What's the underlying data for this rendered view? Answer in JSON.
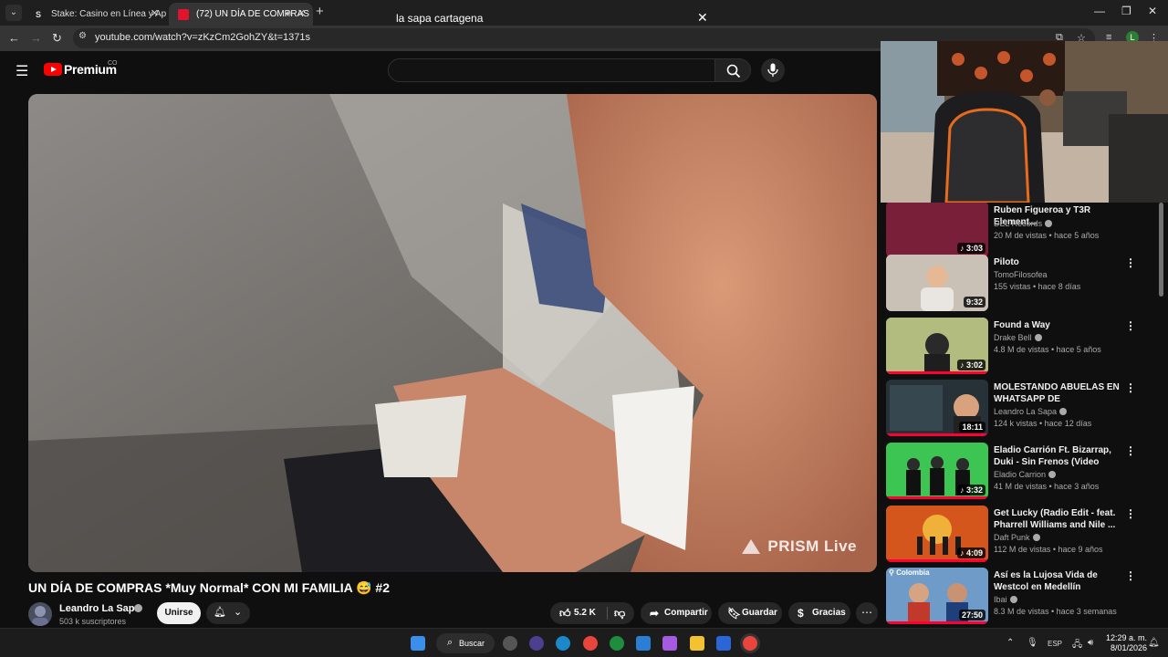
{
  "browser": {
    "tabs": [
      {
        "title": "Stake: Casino en Línea y Apuest",
        "favicon": "S"
      },
      {
        "title": "(72) UN DÍA DE COMPRAS",
        "active": true
      }
    ],
    "url": "youtube.com/watch?v=zKzCm2GohZY&t=1371s",
    "profile_initial": "L"
  },
  "youtube": {
    "brand": "Premium",
    "country": "CO",
    "search_value": "la sapa cartagena"
  },
  "video": {
    "watermark": "PRISM Live",
    "title": "UN DÍA DE COMPRAS *Muy Normal* CON MI FAMILIA 😅 #2",
    "channel": "Leandro La Sapa",
    "subscribers": "503 k suscriptores",
    "join_label": "Unirse",
    "likes": "5.2 K",
    "share_label": "Compartir",
    "save_label": "Guardar",
    "thanks_label": "Gracias"
  },
  "recommendations": [
    {
      "title": "Ruben Figueroa y T3R Element...",
      "channel": "DEL Records",
      "verified": true,
      "meta": "20 M de vistas • hace 5 años",
      "duration": "3:03",
      "music": true,
      "progress": 1.0,
      "thumb_color": "#7a1f3a"
    },
    {
      "title": "Piloto",
      "channel": "TomoFilosofea",
      "verified": false,
      "meta": "155 vistas • hace 8 días",
      "duration": "9:32",
      "music": false,
      "progress": 0,
      "thumb_color": "#b7aea4"
    },
    {
      "title": "Found a Way",
      "channel": "Drake Bell",
      "verified": true,
      "meta": "4.8 M de vistas • hace 5 años",
      "duration": "3:02",
      "music": true,
      "progress": 1.0,
      "thumb_color": "#a7b44a"
    },
    {
      "title": "MOLESTANDO ABUELAS EN WHATSAPP DE SEGUIDORES ...",
      "channel": "Leandro La Sapa",
      "verified": true,
      "meta": "124 k vistas • hace 12 días",
      "duration": "18:11",
      "music": false,
      "progress": 1.0,
      "thumb_color": "#3a3f4a"
    },
    {
      "title": "Eladio Carrión Ft. Bizarrap, Duki - Sin Frenos (Video Oficial)",
      "channel": "Eladio Carrion",
      "verified": true,
      "meta": "41 M de vistas • hace 3 años",
      "duration": "3:32",
      "music": true,
      "progress": 1.0,
      "thumb_color": "#35b34a"
    },
    {
      "title": "Get Lucky (Radio Edit - feat. Pharrell Williams and Nile ...",
      "channel": "Daft Punk",
      "verified": true,
      "meta": "112 M de vistas • hace 9 años",
      "duration": "4:09",
      "music": true,
      "progress": 1.0,
      "thumb_color": "#c2411e"
    },
    {
      "title": "Así es la Lujosa Vida de Westcol en Medellín",
      "channel": "Ibai",
      "verified": true,
      "meta": "8.3 M de vistas • hace 3 semanas",
      "duration": "27:50",
      "music": false,
      "progress": 1.0,
      "thumb_color": "#2f6fb0",
      "tag": "Colombia"
    }
  ],
  "taskbar": {
    "search_label": "Buscar",
    "language": "ESP",
    "time": "12:29 a. m.",
    "date": "8/01/2026"
  },
  "colors": {
    "accent": "#ff0033",
    "background": "#0f0f0f"
  }
}
